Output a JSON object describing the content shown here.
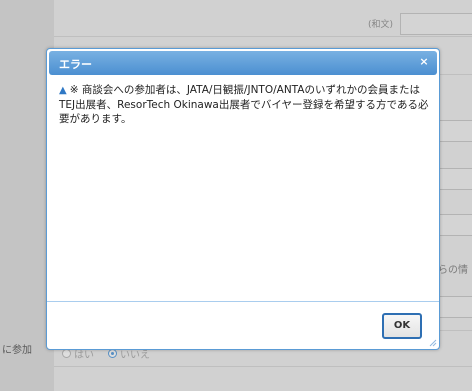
{
  "background": {
    "label_wabun": "(和文)",
    "cut_text": "からの情",
    "join_label": "に参加",
    "radio_options": [
      {
        "label": "はい",
        "checked": false
      },
      {
        "label": "いいえ",
        "checked": true
      }
    ]
  },
  "dialog": {
    "title": "エラー",
    "close_icon": "×",
    "message_icon": "▲",
    "message": "※ 商談会への参加者は、JATA/日観振/JNTO/ANTAのいずれかの会員またはTEJ出展者、ResorTech Okinawa出展者でバイヤー登録を希望する方である必要があります。",
    "ok_label": "OK"
  },
  "colors": {
    "titlebar": "#4b8fd1",
    "accent": "#2e6fb3"
  }
}
